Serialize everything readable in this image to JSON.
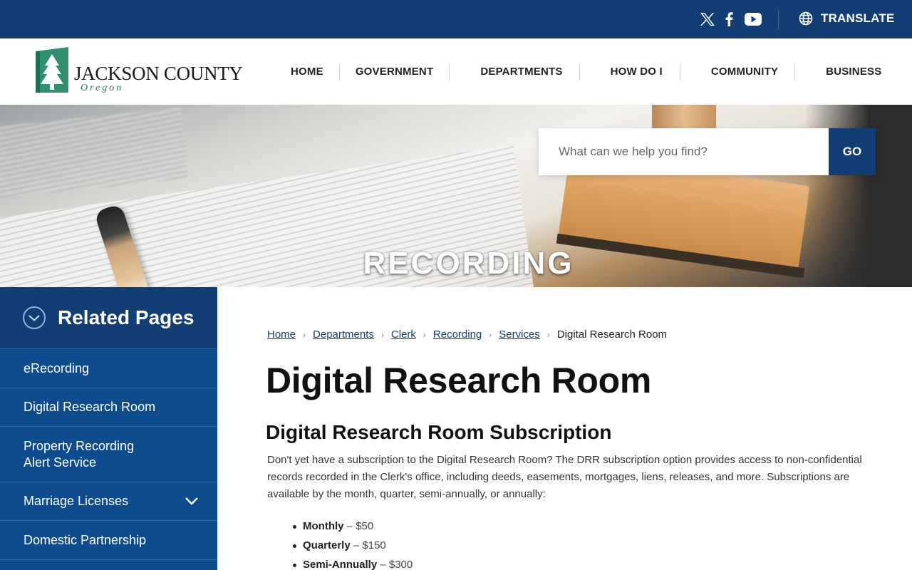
{
  "topbar": {
    "social": [
      "x-icon",
      "facebook-icon",
      "youtube-icon"
    ],
    "translate_label": "TRANSLATE"
  },
  "logo": {
    "name": "JACKSON COUNTY",
    "state": "Oregon"
  },
  "nav": {
    "items": [
      {
        "label": "HOME"
      },
      {
        "label": "GOVERNMENT"
      },
      {
        "label": "DEPARTMENTS"
      },
      {
        "label": "HOW DO I"
      },
      {
        "label": "COMMUNITY"
      },
      {
        "label": "BUSINESS"
      }
    ]
  },
  "hero": {
    "title": "RECORDING"
  },
  "search": {
    "placeholder": "What can we help you find?",
    "button_label": "GO"
  },
  "sidebar": {
    "heading": "Related Pages",
    "items": [
      {
        "label": "eRecording"
      },
      {
        "label": "Digital Research Room"
      },
      {
        "label": "Property Recording\nAlert Service"
      },
      {
        "label": "Marriage Licenses"
      },
      {
        "label": "Domestic Partnership"
      }
    ]
  },
  "breadcrumb": {
    "items": [
      "Home",
      "Departments",
      "Clerk",
      "Recording",
      "Services"
    ],
    "current": "Digital Research Room"
  },
  "main": {
    "title": "Digital Research Room",
    "subtitle": "Digital Research Room Subscription",
    "intro": "Don't yet have a subscription to the Digital Research Room? The DRR subscription option provides access to non-confidential records recorded in the Clerk's office, including deeds, easements, mortgages, liens, releases, and more. Subscriptions are available by the month, quarter, semi-annually, or annually:",
    "prices": [
      {
        "term": "Monthly",
        "price": "$50"
      },
      {
        "term": "Quarterly",
        "price": "$150"
      },
      {
        "term": "Semi-Annually",
        "price": "$300"
      }
    ]
  },
  "colors": {
    "primary_navy": "#123e74",
    "sidebar_blue": "#0e4c8e",
    "logo_green": "#2a7a5a"
  }
}
